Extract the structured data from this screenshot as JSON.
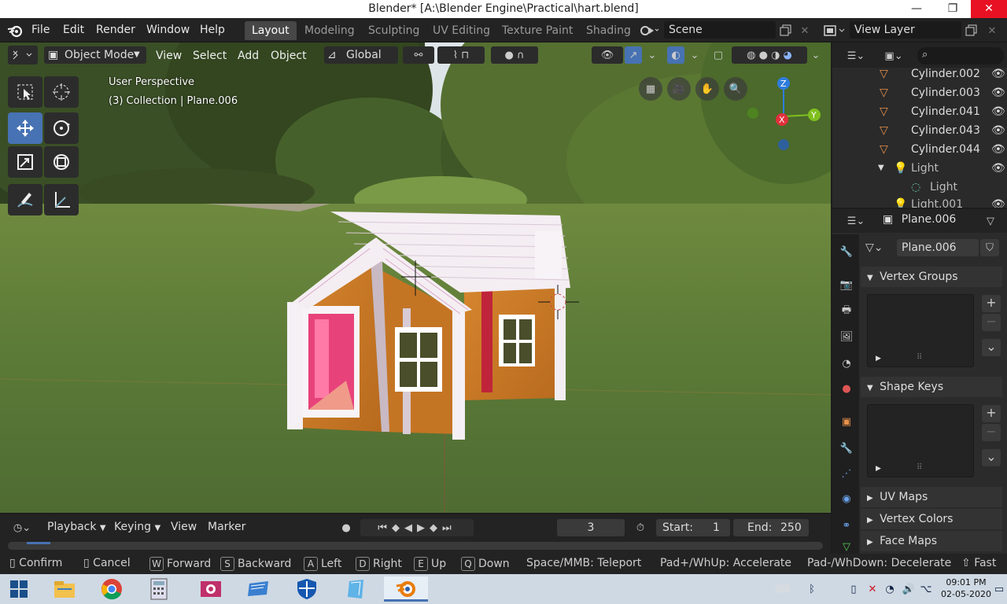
{
  "window": {
    "title": "Blender* [A:\\Blender Engine\\Practical\\hart.blend]",
    "minimize": "—",
    "maximize": "❐",
    "close": "✕"
  },
  "menus": [
    "File",
    "Edit",
    "Render",
    "Window",
    "Help"
  ],
  "workspaces": [
    {
      "label": "Layout",
      "active": true
    },
    {
      "label": "Modeling",
      "active": false
    },
    {
      "label": "Sculpting",
      "active": false
    },
    {
      "label": "UV Editing",
      "active": false
    },
    {
      "label": "Texture Paint",
      "active": false
    },
    {
      "label": "Shading",
      "active": false
    }
  ],
  "scene": {
    "name": "Scene",
    "view_layer": "View Layer"
  },
  "viewport_header": {
    "mode": "Object Mode",
    "view": "View",
    "select": "Select",
    "add": "Add",
    "object": "Object",
    "orientation": "Global"
  },
  "viewport_overlay": {
    "perspective": "User Perspective",
    "collection": "(3) Collection | Plane.006"
  },
  "gizmo": {
    "z": "Z",
    "y": "Y",
    "x": "X"
  },
  "outliner": {
    "items": [
      {
        "label": "Cylinder.002",
        "icon": "mesh-icon"
      },
      {
        "label": "Cylinder.003",
        "icon": "mesh-icon"
      },
      {
        "label": "Cylinder.041",
        "icon": "mesh-icon"
      },
      {
        "label": "Cylinder.043",
        "icon": "mesh-icon"
      },
      {
        "label": "Cylinder.044",
        "icon": "mesh-icon"
      },
      {
        "label": "Light",
        "icon": "light-icon"
      },
      {
        "label": "Light",
        "icon": "light-data-icon"
      },
      {
        "label": "Light.001",
        "icon": "light-icon"
      }
    ]
  },
  "properties": {
    "object_name": "Plane.006",
    "mesh_name": "Plane.006",
    "panels": {
      "vertex_groups": "Vertex Groups",
      "shape_keys": "Shape Keys",
      "uv_maps": "UV Maps",
      "vertex_colors": "Vertex Colors",
      "face_maps": "Face Maps"
    }
  },
  "timeline": {
    "playback": "Playback",
    "keying": "Keying",
    "view": "View",
    "marker": "Marker",
    "current_frame": "3",
    "start_label": "Start:",
    "start": "1",
    "end_label": "End:",
    "end": "250"
  },
  "statusbar": [
    {
      "key": "",
      "label": "Confirm"
    },
    {
      "key": "",
      "label": "Cancel"
    },
    {
      "key": "W",
      "label": "Forward"
    },
    {
      "key": "S",
      "label": "Backward"
    },
    {
      "key": "A",
      "label": "Left"
    },
    {
      "key": "D",
      "label": "Right"
    },
    {
      "key": "E",
      "label": "Up"
    },
    {
      "key": "Q",
      "label": "Down"
    },
    {
      "key": "",
      "label": "Space/MMB: Teleport"
    },
    {
      "key": "",
      "label": "Pad+/WhUp: Accelerate"
    },
    {
      "key": "",
      "label": "Pad-/WhDown: Decelerate"
    },
    {
      "key": "",
      "label": "Fast"
    }
  ],
  "taskbar": {
    "time": "09:01 PM",
    "date": "02-05-2020"
  }
}
